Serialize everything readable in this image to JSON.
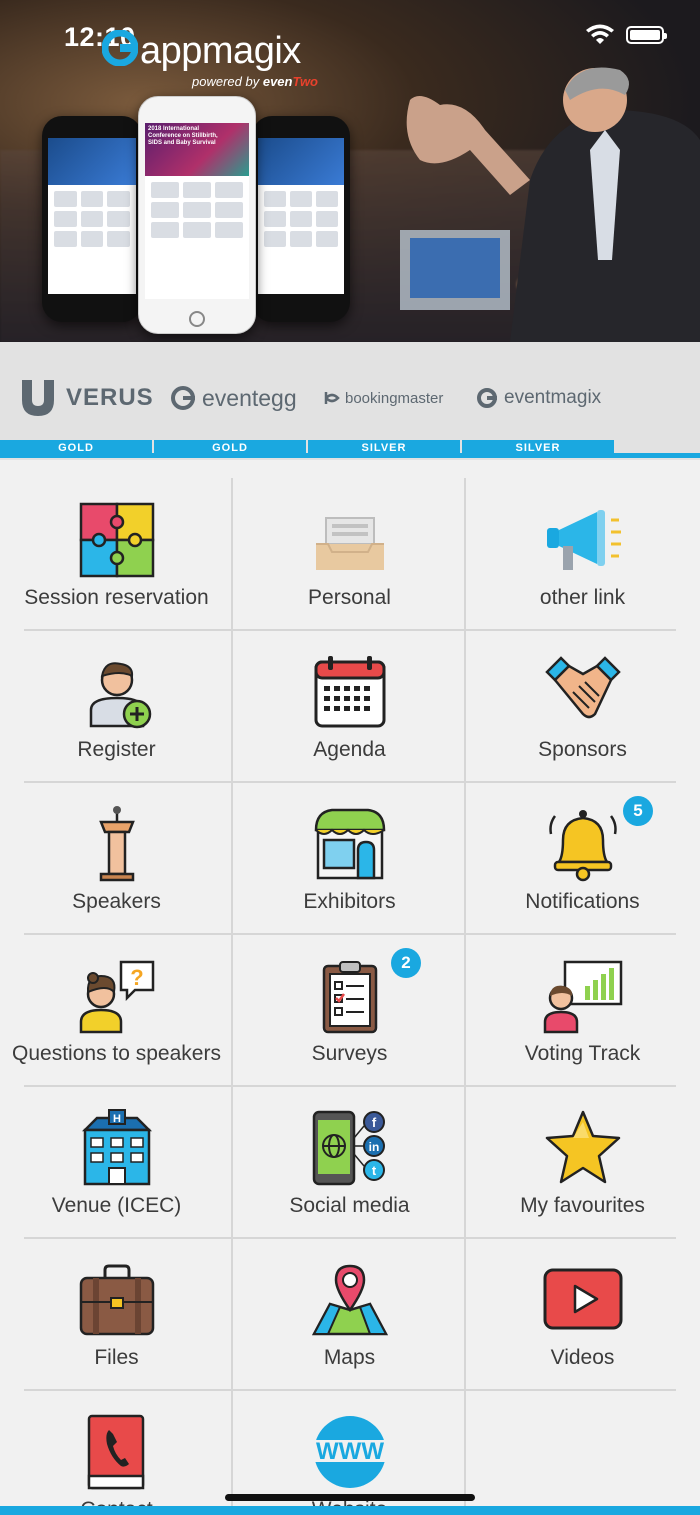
{
  "status_bar": {
    "time": "12:10"
  },
  "banner": {
    "logo_text": "appmagix",
    "tagline_prefix": "powered by",
    "tagline_brand_a": "even",
    "tagline_brand_b": "Two",
    "phone_center_title": "2018 International Conference on Stillbirth, SIDS and Baby Survival"
  },
  "sponsors": {
    "items": [
      {
        "name": "VERUS",
        "tier": "GOLD"
      },
      {
        "name": "eventegg",
        "tier": "GOLD"
      },
      {
        "name": "bookingmaster",
        "tier": "SILVER"
      },
      {
        "name": "eventmagix",
        "tier": "SILVER"
      }
    ]
  },
  "menu": {
    "tiles": [
      {
        "label": "Session reservation",
        "icon": "puzzle-icon"
      },
      {
        "label": "Personal",
        "icon": "inbox-drawer-icon"
      },
      {
        "label": "other link",
        "icon": "megaphone-icon"
      },
      {
        "label": "Register",
        "icon": "user-add-icon"
      },
      {
        "label": "Agenda",
        "icon": "calendar-icon"
      },
      {
        "label": "Sponsors",
        "icon": "handshake-icon"
      },
      {
        "label": "Speakers",
        "icon": "podium-icon"
      },
      {
        "label": "Exhibitors",
        "icon": "storefront-icon"
      },
      {
        "label": "Notifications",
        "icon": "bell-icon",
        "badge": "5"
      },
      {
        "label": "Questions to speakers",
        "icon": "question-person-icon"
      },
      {
        "label": "Surveys",
        "icon": "clipboard-icon",
        "badge": "2"
      },
      {
        "label": "Voting Track",
        "icon": "presentation-chart-icon"
      },
      {
        "label": "Venue (ICEC)",
        "icon": "hotel-icon"
      },
      {
        "label": "Social media",
        "icon": "social-phone-icon"
      },
      {
        "label": "My favourites",
        "icon": "star-icon"
      },
      {
        "label": "Files",
        "icon": "briefcase-icon"
      },
      {
        "label": "Maps",
        "icon": "map-pin-icon"
      },
      {
        "label": "Videos",
        "icon": "play-video-icon"
      },
      {
        "label": "Contact",
        "icon": "phone-book-icon"
      },
      {
        "label": "Website",
        "icon": "www-globe-icon"
      }
    ]
  },
  "colors": {
    "accent": "#1aa8e0",
    "tile_bg": "#f1f1f1",
    "divider": "#d6d6d6"
  }
}
